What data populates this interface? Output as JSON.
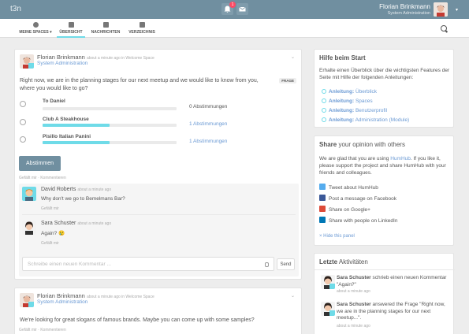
{
  "topbar": {
    "brand": "t3n",
    "notification_count": "1",
    "user_name": "Florian Brinkmann",
    "user_role": "System Administration"
  },
  "subnav": {
    "items": [
      {
        "label": "MEINE SPACES ▾",
        "icon": "spaces-icon"
      },
      {
        "label": "ÜBERSICHT",
        "icon": "dashboard-icon"
      },
      {
        "label": "NACHRICHTEN",
        "icon": "mail-icon"
      },
      {
        "label": "VERZEICHNIS",
        "icon": "book-icon"
      }
    ]
  },
  "post1": {
    "author": "Florian Brinkmann",
    "meta": "about a minute ago in Welcome Space",
    "subtitle": "System Administration",
    "question": "Right now, we are in the planning stages for our next meetup and we would like to know from you, where you would like to go?",
    "tag": "FRAGE",
    "options": [
      {
        "label": "To Daniel",
        "votes": "0 Abstimmungen",
        "percent": 0
      },
      {
        "label": "Club A Steakhouse",
        "votes": "1 Abstimmungen",
        "percent": 50
      },
      {
        "label": "Pisillo Italian Panini",
        "votes": "1 Abstimmungen",
        "percent": 50
      }
    ],
    "vote_button": "Abstimmen",
    "actions": "Gefällt mir · Kommentieren",
    "comments": [
      {
        "name": "David Roberts",
        "meta": "about a minute ago",
        "text": "Why don't we go to Bemelmans Bar?",
        "like": "Gefällt mir"
      },
      {
        "name": "Sara Schuster",
        "meta": "about a minute ago",
        "text": "Again? 😢",
        "like": "Gefällt mir"
      }
    ],
    "comment_placeholder": "Schreibe einen neuen Kommentar ...",
    "send": "Send"
  },
  "post2": {
    "author": "Florian Brinkmann",
    "meta": "about a minute ago in Welcome Space",
    "subtitle": "System Administration",
    "text": "We're looking for great slogans of famous brands. Maybe you can come up with some samples?",
    "actions": "Gefällt mir · Kommentieren"
  },
  "help_panel": {
    "title": "Hilfe beim Start",
    "text": "Erhalte einen Überblick über die wichtigsten Features der Seite mit Hilfe der folgenden Anleitungen:",
    "links": [
      {
        "bold": "Anleitung:",
        "rest": " Überblick"
      },
      {
        "bold": "Anleitung:",
        "rest": " Spaces"
      },
      {
        "bold": "Anleitung:",
        "rest": " Benutzerprofil"
      },
      {
        "bold": "Anleitung:",
        "rest": " Administration (Module)"
      }
    ]
  },
  "share_panel": {
    "title_bold": "Share",
    "title_light": " your opinion with others",
    "text_a": "We are glad that you are using ",
    "text_link": "HumHub",
    "text_b": ". If you like it, please support the project and share HumHub with your friends and colleagues.",
    "items": [
      {
        "label": "Tweet about HumHub",
        "icon": "twitter-icon",
        "color": "#55acee"
      },
      {
        "label": "Post a message on Facebook",
        "icon": "facebook-icon",
        "color": "#3b5998"
      },
      {
        "label": "Share on Google+",
        "icon": "google-plus-icon",
        "color": "#dd4b39"
      },
      {
        "label": "Share with people on LinkedIn",
        "icon": "linkedin-icon",
        "color": "#0077b5"
      }
    ],
    "hide": "× Hide this panel"
  },
  "activity_panel": {
    "title_bold": "Letzte",
    "title_light": " Aktivitäten",
    "items": [
      {
        "name": "Sara Schuster",
        "text": " schrieb einen neuen Kommentar \"Again?\"",
        "time": "about a minute ago"
      },
      {
        "name": "Sara Schuster",
        "text": " answered the Frage \"Right now, we are in the planning stages for our next meetup...\".",
        "time": "about a minute ago"
      }
    ]
  },
  "colors": {
    "topbar": "#708fa0",
    "accent": "#6fdbe8",
    "link": "#6b9ad4",
    "badge": "#fc4a64"
  }
}
